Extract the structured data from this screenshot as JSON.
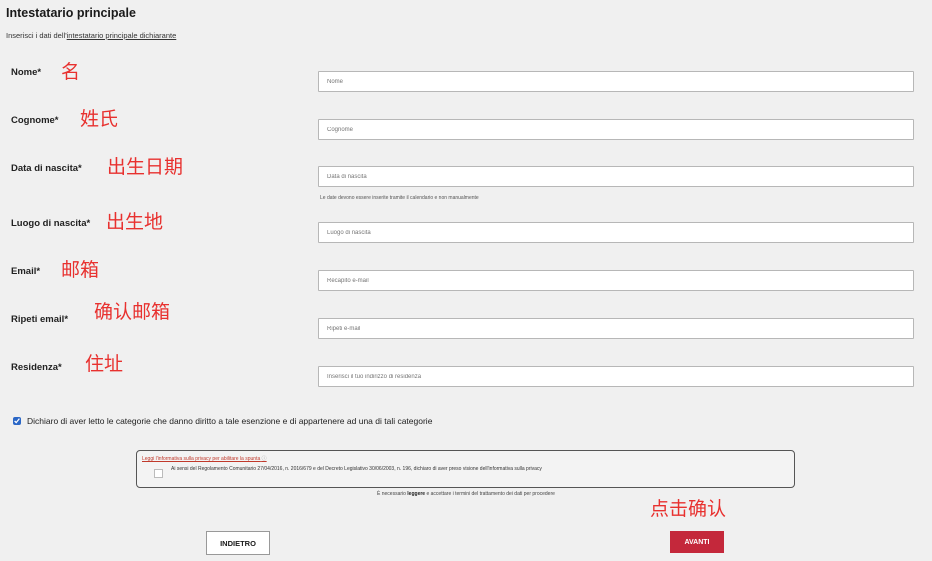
{
  "header": {
    "title": "Intestatario principale",
    "intro_prefix": "Inserisci i dati dell'",
    "intro_link": "intestatario principale dichiarante"
  },
  "fields": {
    "nome": {
      "label": "Nome*",
      "annotation": "名",
      "placeholder": "Nome"
    },
    "cognome": {
      "label": "Cognome*",
      "annotation": "姓氏",
      "placeholder": "Cognome"
    },
    "data_nascita": {
      "label": "Data di nascita*",
      "annotation": "出生日期",
      "placeholder": "Data di nascita",
      "hint": "Le date devono essere inserite tramite il calendario e non manualmente"
    },
    "luogo_nascita": {
      "label": "Luogo di nascita*",
      "annotation": "出生地",
      "placeholder": "Luogo di nascita"
    },
    "email": {
      "label": "Email*",
      "annotation": "邮箱",
      "placeholder": "Recapito e-mail"
    },
    "ripeti_email": {
      "label": "Ripeti email*",
      "annotation": "确认邮箱",
      "placeholder": "Ripeti e-mail"
    },
    "residenza": {
      "label": "Residenza*",
      "annotation": "住址",
      "placeholder": "Inserisci il tuo indirizzo di residenza"
    }
  },
  "consent": {
    "checked": true,
    "text": "Dichiaro di aver letto le categorie che danno diritto a tale esenzione e di appartenere ad una di tali categorie"
  },
  "privacy": {
    "link": "Leggi l'informativa sulla privacy per abilitare la spunta",
    "info_icon": "ⓘ",
    "text": "Ai sensi del Regolamento Comunitario 27/04/2016, n. 2016/679 e del Decreto Legislativo 30/06/2003, n. 196, dichiaro di aver preso visione dell'informativa sulla privacy",
    "note_prefix": "È necessario",
    "note_bold": "leggere",
    "note_suffix": "e accettare i termini del trattamento dei dati per procedere"
  },
  "actions": {
    "back_label": "INDIETRO",
    "next_label": "AVANTI",
    "next_annotation": "点击确认",
    "next_color": "#c4283b"
  }
}
